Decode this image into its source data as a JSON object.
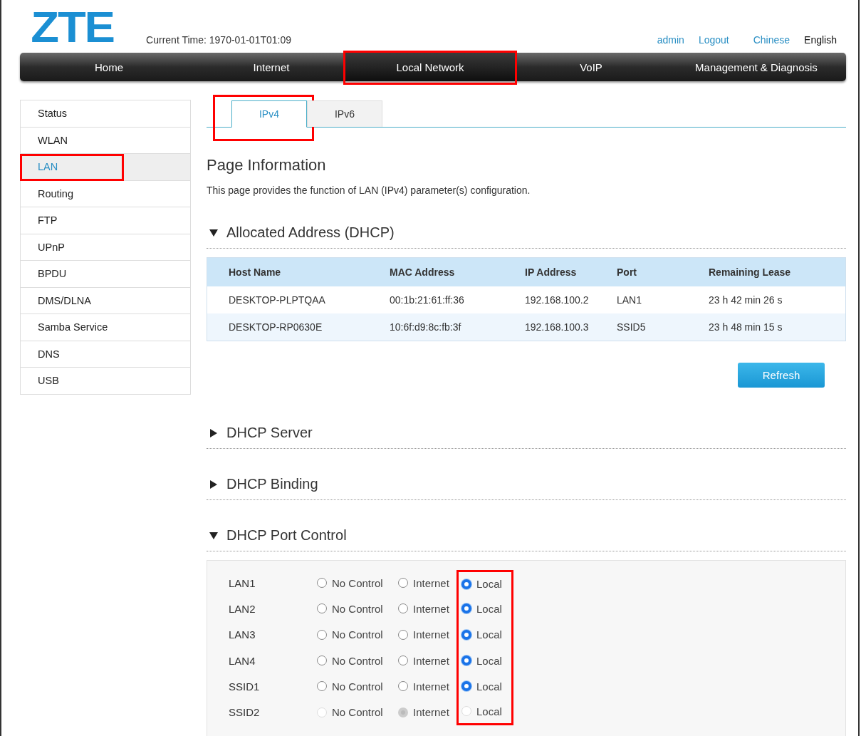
{
  "header": {
    "logo": "ZTE",
    "current_time": "Current Time: 1970-01-01T01:09",
    "links": [
      {
        "label": "admin",
        "kind": "link"
      },
      {
        "label": "Logout",
        "kind": "link"
      },
      {
        "label": "Chinese",
        "kind": "link"
      },
      {
        "label": "English",
        "kind": "current"
      }
    ]
  },
  "nav": [
    {
      "label": "Home",
      "selected": false,
      "highlighted": false
    },
    {
      "label": "Internet",
      "selected": false,
      "highlighted": false
    },
    {
      "label": "Local Network",
      "selected": true,
      "highlighted": true
    },
    {
      "label": "VoIP",
      "selected": false,
      "highlighted": false
    },
    {
      "label": "Management & Diagnosis",
      "selected": false,
      "highlighted": false
    }
  ],
  "sidebar": [
    {
      "label": "Status",
      "selected": false,
      "highlighted": false
    },
    {
      "label": "WLAN",
      "selected": false,
      "highlighted": false
    },
    {
      "label": "LAN",
      "selected": true,
      "highlighted": true
    },
    {
      "label": "Routing",
      "selected": false,
      "highlighted": false
    },
    {
      "label": "FTP",
      "selected": false,
      "highlighted": false
    },
    {
      "label": "UPnP",
      "selected": false,
      "highlighted": false
    },
    {
      "label": "BPDU",
      "selected": false,
      "highlighted": false
    },
    {
      "label": "DMS/DLNA",
      "selected": false,
      "highlighted": false
    },
    {
      "label": "Samba Service",
      "selected": false,
      "highlighted": false
    },
    {
      "label": "DNS",
      "selected": false,
      "highlighted": false
    },
    {
      "label": "USB",
      "selected": false,
      "highlighted": false
    }
  ],
  "tabs": [
    {
      "label": "IPv4",
      "selected": true,
      "highlighted": true
    },
    {
      "label": "IPv6",
      "selected": false,
      "highlighted": false
    }
  ],
  "page_title": "Page Information",
  "page_description": "This page provides the function of LAN (IPv4) parameter(s) configuration.",
  "sections": [
    {
      "title": "Allocated Address (DHCP)",
      "expanded": true,
      "kind": "table",
      "columns": [
        "Host Name",
        "MAC Address",
        "IP Address",
        "Port",
        "Remaining Lease"
      ],
      "rows": [
        [
          "DESKTOP-PLPTQAA",
          "00:1b:21:61:ff:36",
          "192.168.100.2",
          "LAN1",
          "23 h 42 min 26 s"
        ],
        [
          "DESKTOP-RP0630E",
          "10:6f:d9:8c:fb:3f",
          "192.168.100.3",
          "SSID5",
          "23 h 48 min 15 s"
        ]
      ],
      "button": "Refresh"
    },
    {
      "title": "DHCP Server",
      "expanded": false,
      "kind": "collapsed"
    },
    {
      "title": "DHCP Binding",
      "expanded": false,
      "kind": "collapsed"
    },
    {
      "title": "DHCP Port Control",
      "expanded": true,
      "kind": "port_control",
      "ports": [
        {
          "port": "LAN1",
          "disabled": false,
          "options": [
            {
              "label": "No Control",
              "selected": false,
              "highlighted": false
            },
            {
              "label": "Internet",
              "selected": false,
              "highlighted": false
            },
            {
              "label": "Local",
              "selected": true,
              "highlighted": true
            }
          ]
        },
        {
          "port": "LAN2",
          "disabled": false,
          "options": [
            {
              "label": "No Control",
              "selected": false,
              "highlighted": false
            },
            {
              "label": "Internet",
              "selected": false,
              "highlighted": false
            },
            {
              "label": "Local",
              "selected": true,
              "highlighted": true
            }
          ]
        },
        {
          "port": "LAN3",
          "disabled": false,
          "options": [
            {
              "label": "No Control",
              "selected": false,
              "highlighted": false
            },
            {
              "label": "Internet",
              "selected": false,
              "highlighted": false
            },
            {
              "label": "Local",
              "selected": true,
              "highlighted": true
            }
          ]
        },
        {
          "port": "LAN4",
          "disabled": false,
          "options": [
            {
              "label": "No Control",
              "selected": false,
              "highlighted": false
            },
            {
              "label": "Internet",
              "selected": false,
              "highlighted": false
            },
            {
              "label": "Local",
              "selected": true,
              "highlighted": true
            }
          ]
        },
        {
          "port": "SSID1",
          "disabled": false,
          "options": [
            {
              "label": "No Control",
              "selected": false,
              "highlighted": false
            },
            {
              "label": "Internet",
              "selected": false,
              "highlighted": false
            },
            {
              "label": "Local",
              "selected": true,
              "highlighted": true
            }
          ]
        },
        {
          "port": "SSID2",
          "disabled": true,
          "options": [
            {
              "label": "No Control",
              "selected": false,
              "highlighted": false
            },
            {
              "label": "Internet",
              "selected": true,
              "highlighted": false
            },
            {
              "label": "Local",
              "selected": false,
              "highlighted": true
            }
          ]
        }
      ]
    }
  ]
}
